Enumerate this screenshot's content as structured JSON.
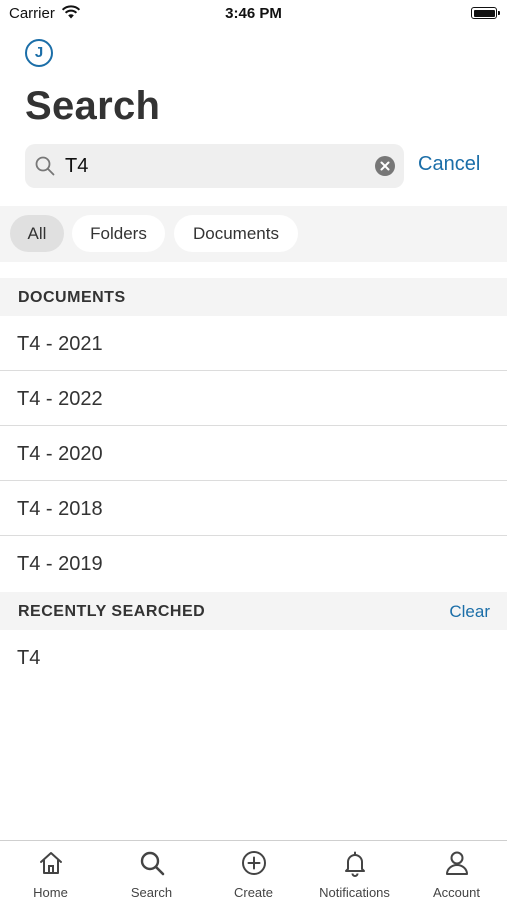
{
  "status_bar": {
    "carrier": "Carrier",
    "time": "3:46 PM"
  },
  "header": {
    "avatar_initial": "J",
    "title": "Search"
  },
  "search": {
    "query": "T4",
    "cancel_label": "Cancel"
  },
  "filters": [
    {
      "label": "All",
      "active": true
    },
    {
      "label": "Folders",
      "active": false
    },
    {
      "label": "Documents",
      "active": false
    }
  ],
  "documents_section": {
    "header": "DOCUMENTS",
    "items": [
      "T4 - 2021",
      "T4 - 2022",
      "T4 - 2020",
      "T4 - 2018",
      "T4 - 2019"
    ]
  },
  "recent_section": {
    "header": "RECENTLY SEARCHED",
    "clear_label": "Clear",
    "items": [
      "T4"
    ]
  },
  "tab_bar": {
    "items": [
      {
        "label": "Home",
        "icon": "home-icon"
      },
      {
        "label": "Search",
        "icon": "search-icon"
      },
      {
        "label": "Create",
        "icon": "plus-circle-icon"
      },
      {
        "label": "Notifications",
        "icon": "bell-icon"
      },
      {
        "label": "Account",
        "icon": "person-icon"
      }
    ]
  },
  "colors": {
    "accent": "#1b6ea8",
    "section_bg": "#f4f4f4",
    "text": "#333333"
  }
}
